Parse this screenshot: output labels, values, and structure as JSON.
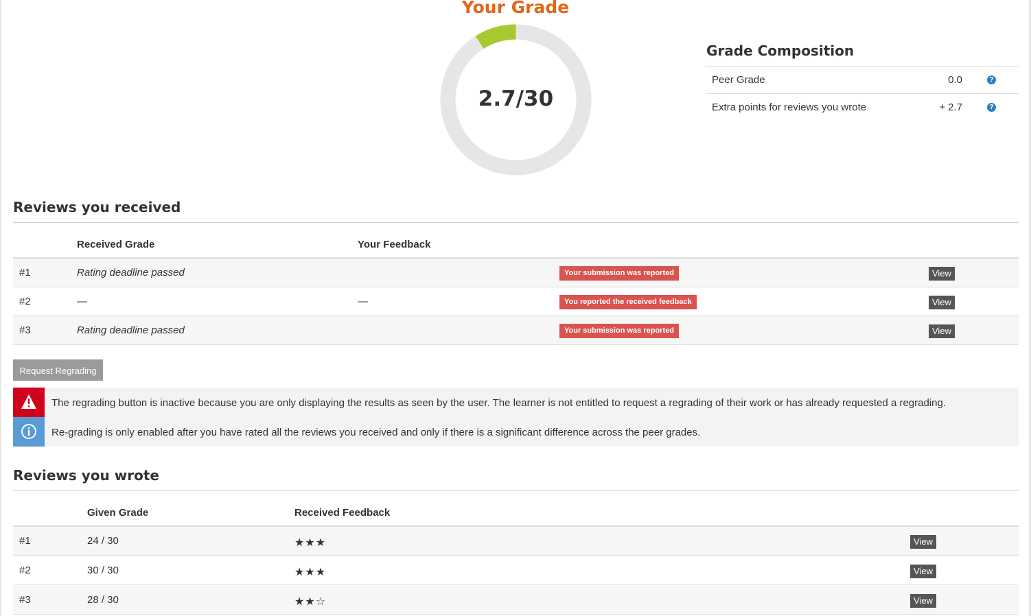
{
  "grade": {
    "title": "Your Grade",
    "display": "2.7/30",
    "earned": 2.7,
    "max": 30,
    "colors": {
      "track": "#e6e6e6",
      "fill": "#a6c930",
      "title": "#e0661a"
    }
  },
  "composition": {
    "title": "Grade Composition",
    "rows": [
      {
        "label": "Peer Grade",
        "value": "0.0",
        "icon": "help-icon"
      },
      {
        "label": "Extra points for reviews you wrote",
        "value": "+ 2.7",
        "icon": "help-icon"
      }
    ]
  },
  "received": {
    "title": "Reviews you received",
    "headers": {
      "grade": "Received Grade",
      "feedback": "Your Feedback"
    },
    "rows": [
      {
        "num": "#1",
        "grade": "Rating deadline passed",
        "feedback": "",
        "badge": "Your submission was reported",
        "action": "View"
      },
      {
        "num": "#2",
        "grade": "—",
        "feedback": "—",
        "badge": "You reported the received feedback",
        "action": "View"
      },
      {
        "num": "#3",
        "grade": "Rating deadline passed",
        "feedback": "",
        "badge": "Your submission was reported",
        "action": "View"
      }
    ],
    "regrade_label": "Request Regrading"
  },
  "alerts": [
    {
      "type": "warning",
      "icon": "warning-icon",
      "color": "#d0021b",
      "text": "The regrading button is inactive because you are only displaying the results as seen by the user. The learner is not entitled to request a regrading of their work or has already requested a regrading."
    },
    {
      "type": "info",
      "icon": "info-icon",
      "color": "#5b9bd5",
      "text": "Re-grading is only enabled after you have rated all the reviews you received and only if there is a significant difference across the peer grades."
    }
  ],
  "wrote": {
    "title": "Reviews you wrote",
    "headers": {
      "grade": "Given Grade",
      "feedback": "Received Feedback"
    },
    "rows": [
      {
        "num": "#1",
        "grade": "24 / 30",
        "stars": "★★★",
        "rating": 3,
        "action": "View"
      },
      {
        "num": "#2",
        "grade": "30 / 30",
        "stars": "★★★",
        "rating": 3,
        "action": "View"
      },
      {
        "num": "#3",
        "grade": "28 / 30",
        "stars": "★★☆",
        "rating": 2,
        "action": "View"
      }
    ]
  }
}
